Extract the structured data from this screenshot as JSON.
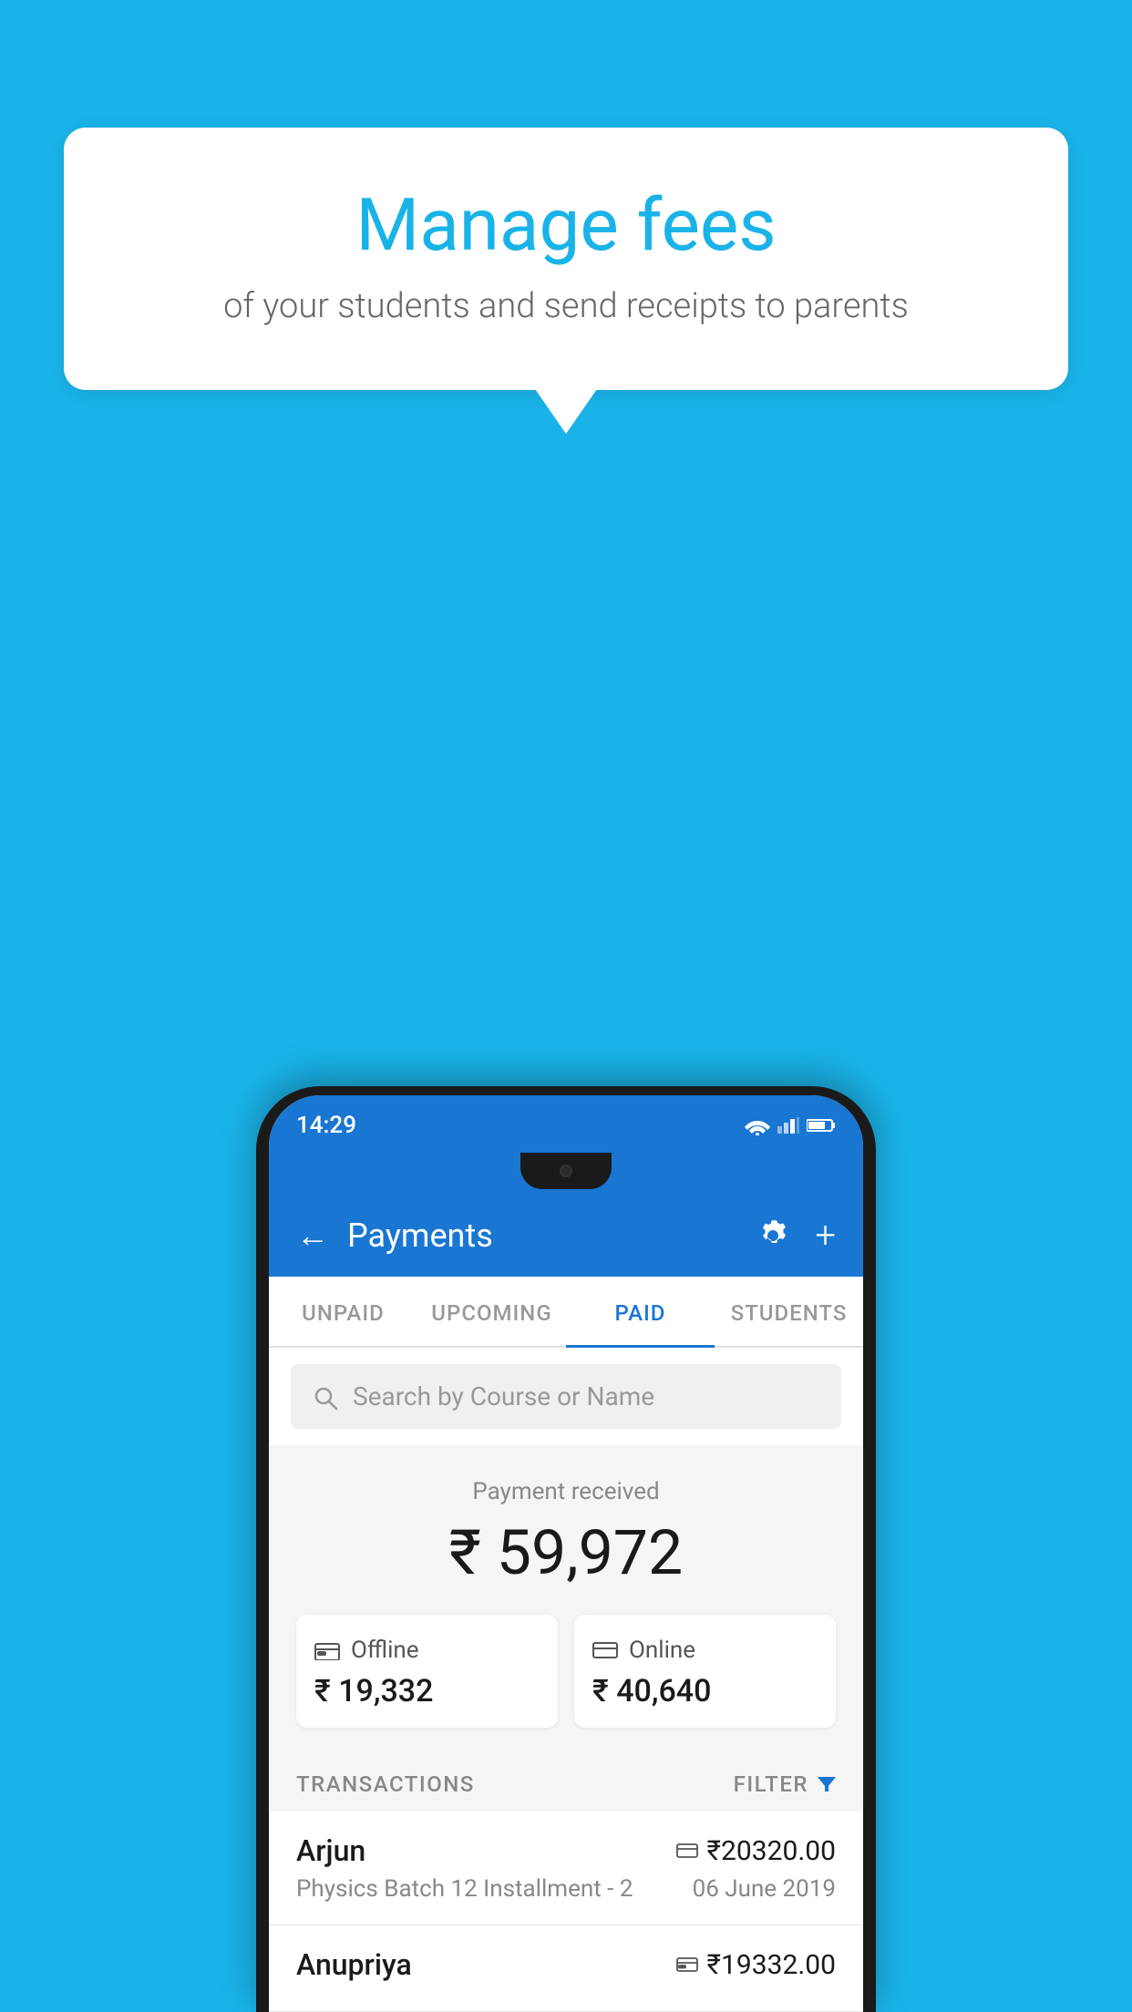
{
  "background_color": "#1ab3e8",
  "speech_bubble": {
    "title": "Manage fees",
    "subtitle": "of your students and send receipts to parents"
  },
  "status_bar": {
    "time": "14:29"
  },
  "app_bar": {
    "title": "Payments",
    "back_label": "←",
    "settings_label": "⚙",
    "add_label": "+"
  },
  "tabs": [
    {
      "id": "unpaid",
      "label": "UNPAID",
      "active": false
    },
    {
      "id": "upcoming",
      "label": "UPCOMING",
      "active": false
    },
    {
      "id": "paid",
      "label": "PAID",
      "active": true
    },
    {
      "id": "students",
      "label": "STUDENTS",
      "active": false
    }
  ],
  "search": {
    "placeholder": "Search by Course or Name"
  },
  "payment_summary": {
    "label": "Payment received",
    "total": "₹ 59,972",
    "offline_label": "Offline",
    "offline_amount": "₹ 19,332",
    "online_label": "Online",
    "online_amount": "₹ 40,640"
  },
  "transactions_section": {
    "label": "TRANSACTIONS",
    "filter_label": "FILTER"
  },
  "transactions": [
    {
      "name": "Arjun",
      "course": "Physics Batch 12 Installment - 2",
      "amount": "₹20320.00",
      "date": "06 June 2019",
      "type": "online"
    },
    {
      "name": "Anupriya",
      "course": "",
      "amount": "₹19332.00",
      "date": "",
      "type": "offline"
    }
  ]
}
